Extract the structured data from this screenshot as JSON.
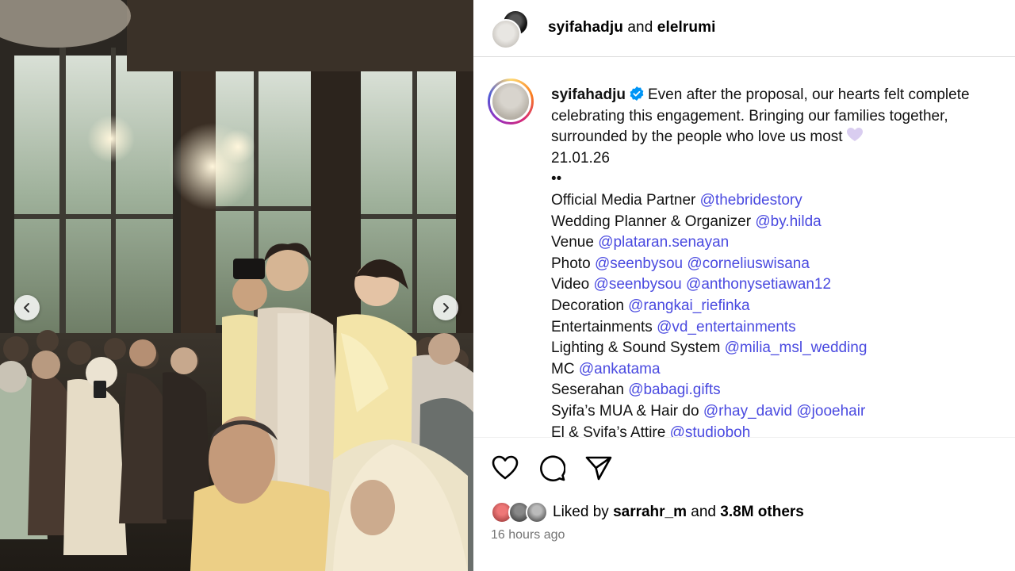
{
  "header": {
    "user1": "syifahadju",
    "and": "and",
    "user2": "elelrumi"
  },
  "caption": {
    "username": "syifahadju",
    "text_line1": "Even after the proposal, our hearts felt complete",
    "text_line2": "celebrating this engagement. Bringing our families together,",
    "text_line3": "surrounded by the people who love us most",
    "date": "21.01.26",
    "dots": "••",
    "credits": [
      {
        "label": "Official Media Partner",
        "tags": [
          "@thebridestory"
        ]
      },
      {
        "label": "Wedding Planner & Organizer",
        "tags": [
          "@by.hilda"
        ]
      },
      {
        "label": "Venue",
        "tags": [
          "@plataran.senayan"
        ]
      },
      {
        "label": "Photo",
        "tags": [
          "@seenbysou",
          "@corneliuswisana"
        ]
      },
      {
        "label": "Video",
        "tags": [
          "@seenbysou",
          "@anthonysetiawan12"
        ]
      },
      {
        "label": "Decoration",
        "tags": [
          "@rangkai_riefinka"
        ]
      },
      {
        "label": "Entertainments",
        "tags": [
          "@vd_entertainments"
        ]
      },
      {
        "label": "Lighting & Sound System",
        "tags": [
          "@milia_msl_wedding"
        ]
      },
      {
        "label": "MC",
        "tags": [
          "@ankatama"
        ]
      },
      {
        "label": "Seserahan",
        "tags": [
          "@babagi.gifts"
        ]
      },
      {
        "label": "Syifa’s MUA & Hair do",
        "tags": [
          "@rhay_david",
          "@jooehair"
        ]
      },
      {
        "label": "El & Syifa’s Attire",
        "tags": [
          "@studioboh"
        ]
      }
    ]
  },
  "actions": {
    "like_icon": "heart-outline-icon",
    "comment_icon": "comment-bubble-icon",
    "share_icon": "paper-plane-icon"
  },
  "likes": {
    "prefix": "Liked by",
    "user": "sarrahr_m",
    "and": "and",
    "others": "3.8M others"
  },
  "timestamp": "16 hours ago",
  "colors": {
    "link": "#4a4ae0",
    "verified": "#0095f6",
    "muted": "#737373",
    "divider": "#dbdbdb"
  }
}
